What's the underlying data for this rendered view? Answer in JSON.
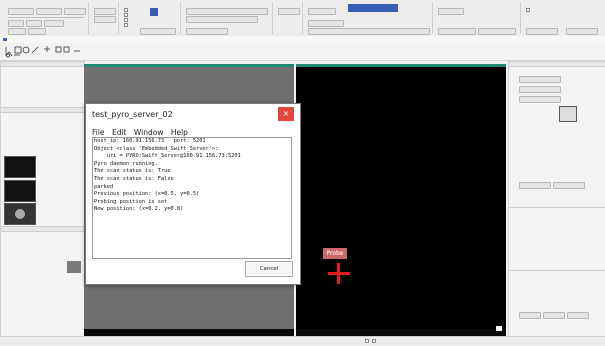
{
  "dialog": {
    "title": "test_pyro_server_02",
    "close_glyph": "×",
    "menu": [
      "File",
      "Edit",
      "Window",
      "Help"
    ],
    "lines": [
      "host_ip: 160.91.156.73   port: 5201",
      "Object <class 'Embedded_Swift_Server'>:",
      "    uri = PYRO:Swift_Server@160.91.156.73:5201",
      "",
      "Pyro daemon running.",
      "",
      "The scan status is: True",
      "The scan status is: False",
      "parked",
      "Previous position: (x=0.5, y=0.5)",
      "Probing position is set",
      "New position: (x=0.2, y=0.8)"
    ],
    "cancel_label": "Cancel"
  },
  "probe": {
    "label": "Probe"
  },
  "colors": {
    "accent_teal": "#1f8a70",
    "probe_red": "#e01e1e",
    "dialog_close": "#e0463a"
  }
}
